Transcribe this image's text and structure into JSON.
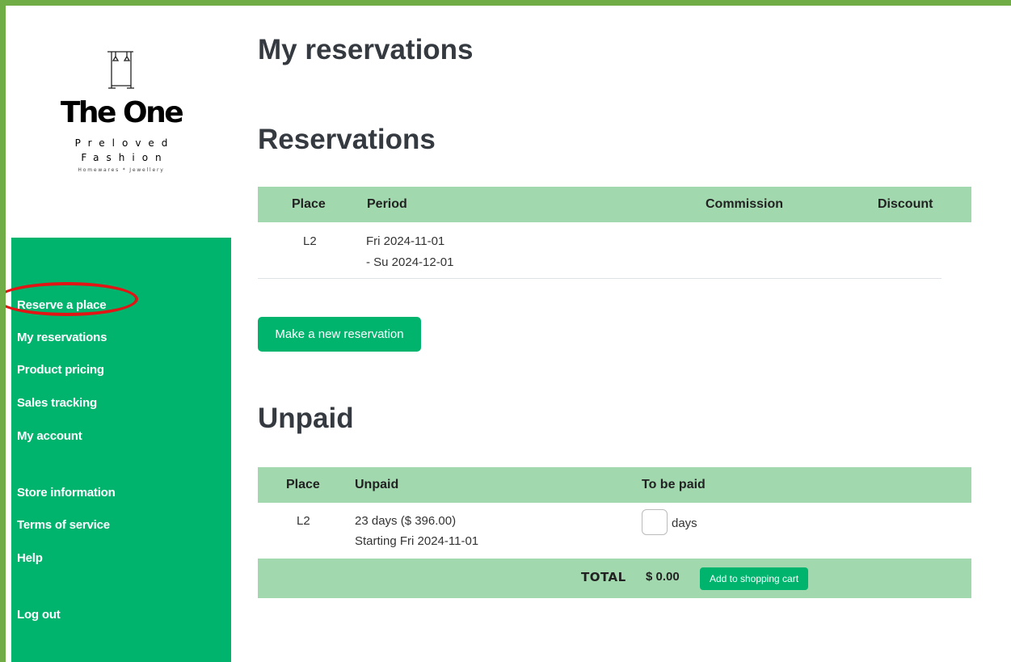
{
  "brand": {
    "name": "The One",
    "line1": "Preloved",
    "line2": "Fashion",
    "tagline": "Homewares * Jewellery"
  },
  "sidebar": {
    "items": [
      {
        "label": "Reserve a place"
      },
      {
        "label": "My reservations"
      },
      {
        "label": "Product pricing"
      },
      {
        "label": "Sales tracking"
      },
      {
        "label": "My account"
      },
      {
        "label": "Store information"
      },
      {
        "label": "Terms of service"
      },
      {
        "label": "Help"
      },
      {
        "label": "Log out"
      }
    ],
    "highlighted": "Reserve a place"
  },
  "page": {
    "title": "My reservations"
  },
  "reservations": {
    "title": "Reservations",
    "columns": [
      "Place",
      "Period",
      "Commission",
      "Discount"
    ],
    "rows": [
      {
        "place": "L2",
        "period_start": "Fri 2024-11-01",
        "period_end": "- Su 2024-12-01",
        "commission": "",
        "discount": ""
      }
    ],
    "new_button": "Make a new reservation"
  },
  "unpaid": {
    "title": "Unpaid",
    "columns": [
      "Place",
      "Unpaid",
      "To be paid"
    ],
    "rows": [
      {
        "place": "L2",
        "unpaid": "23 days ($ 396.00)",
        "starting": "Starting Fri 2024-11-01",
        "to_be_paid_value": "",
        "unit": "days"
      }
    ],
    "total_label": "TOTAL",
    "total_amount": "$ 0.00",
    "cart_button": "Add to shopping cart"
  },
  "colors": {
    "frame": "#70ad47",
    "sidebar": "#00b46e",
    "table_header": "#a2d8ae",
    "highlight_ring": "#e21414"
  }
}
